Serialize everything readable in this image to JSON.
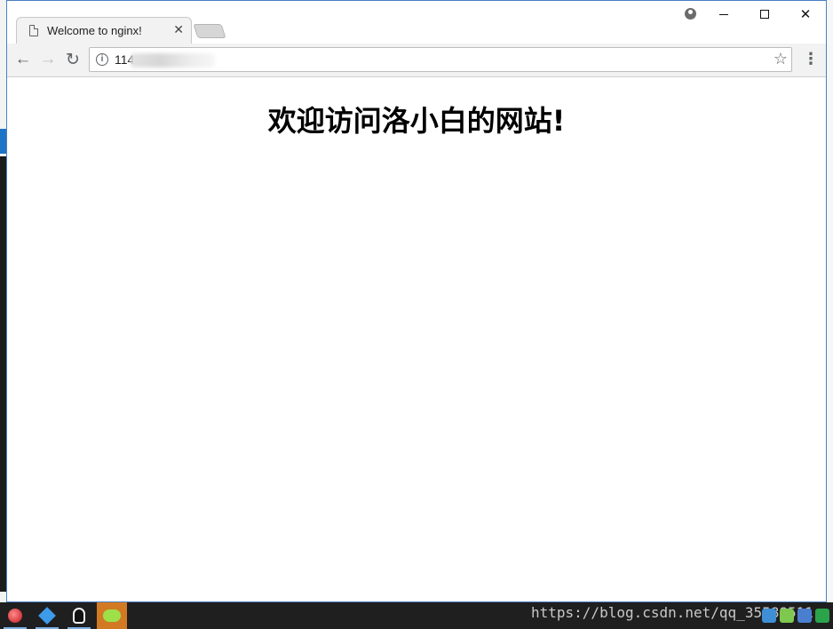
{
  "browser": {
    "tab": {
      "title": "Welcome to nginx!",
      "close_glyph": "✕"
    },
    "address": {
      "visible_prefix": "114"
    },
    "icons": {
      "back": "arrow-left-icon",
      "forward": "arrow-right-icon",
      "reload": "reload-icon",
      "info": "info-icon",
      "bookmark": "star-icon",
      "menu": "kebab-menu-icon",
      "profile": "profile-icon"
    },
    "window_controls": {
      "minimize": "minimize-icon",
      "maximize": "maximize-icon",
      "close": "close-icon"
    }
  },
  "page": {
    "heading": "欢迎访问洛小白的网站!"
  },
  "taskbar": {
    "watermark": "https://blog.csdn.net/qq_35588511",
    "apps": [
      "browser-icon",
      "cube-icon",
      "qq-icon",
      "wechat-icon"
    ],
    "active_app": "wechat-icon",
    "accent_color": "#d27a23"
  },
  "colors": {
    "window_border": "#4a80c4",
    "toolbar_bg": "#f2f2f2",
    "taskbar_bg": "#1f1f1f"
  }
}
